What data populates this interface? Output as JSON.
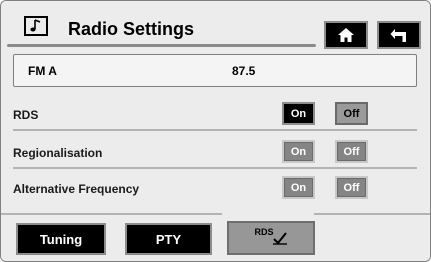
{
  "header": {
    "title": "Radio Settings",
    "home_button": "home-icon",
    "back_button": "back-arrow-icon"
  },
  "frequency": {
    "band": "FM A",
    "value": "87.5"
  },
  "settings": [
    {
      "label": "RDS",
      "on": "On",
      "off": "Off",
      "state": "on"
    },
    {
      "label": "Regionalisation",
      "on": "On",
      "off": "Off",
      "state": "off"
    },
    {
      "label": "Alternative Frequency",
      "on": "On",
      "off": "Off",
      "state": "off"
    }
  ],
  "tabs": {
    "tuning": "Tuning",
    "pty": "PTY",
    "rds": "RDS"
  },
  "colors": {
    "active_button": "#000000",
    "inactive_button": "#858585",
    "background": "#ececec"
  }
}
